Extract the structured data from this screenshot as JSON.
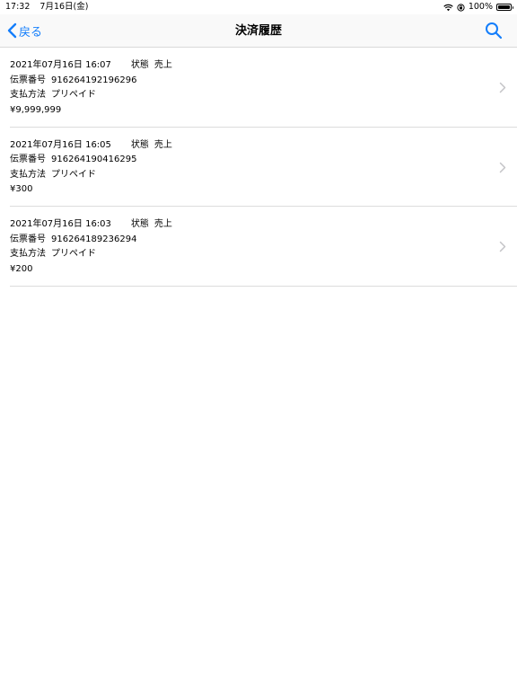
{
  "status": {
    "time": "17:32",
    "date": "7月16日(金)",
    "battery": "100%"
  },
  "nav": {
    "back_label": "戻る",
    "title": "決済履歴"
  },
  "records": [
    {
      "datetime": "2021年07月16日 16:07",
      "status_label": "状態",
      "status_value": "売上",
      "slip_label": "伝票番号",
      "slip_value": "916264192196296",
      "pay_label": "支払方法",
      "pay_value": "プリペイド",
      "amount": "¥9,999,999"
    },
    {
      "datetime": "2021年07月16日 16:05",
      "status_label": "状態",
      "status_value": "売上",
      "slip_label": "伝票番号",
      "slip_value": "916264190416295",
      "pay_label": "支払方法",
      "pay_value": "プリペイド",
      "amount": "¥300"
    },
    {
      "datetime": "2021年07月16日 16:03",
      "status_label": "状態",
      "status_value": "売上",
      "slip_label": "伝票番号",
      "slip_value": "916264189236294",
      "pay_label": "支払方法",
      "pay_value": "プリペイド",
      "amount": "¥200"
    }
  ],
  "icons": {
    "back": "chevron-left-icon",
    "search": "search-icon",
    "row": "chevron-right-icon",
    "wifi": "wifi-icon",
    "lock": "orientation-lock-icon",
    "battery": "battery-icon"
  },
  "colors": {
    "accent": "#147efb",
    "separator": "#dcdcdc",
    "chevron": "#c4c4c7"
  }
}
